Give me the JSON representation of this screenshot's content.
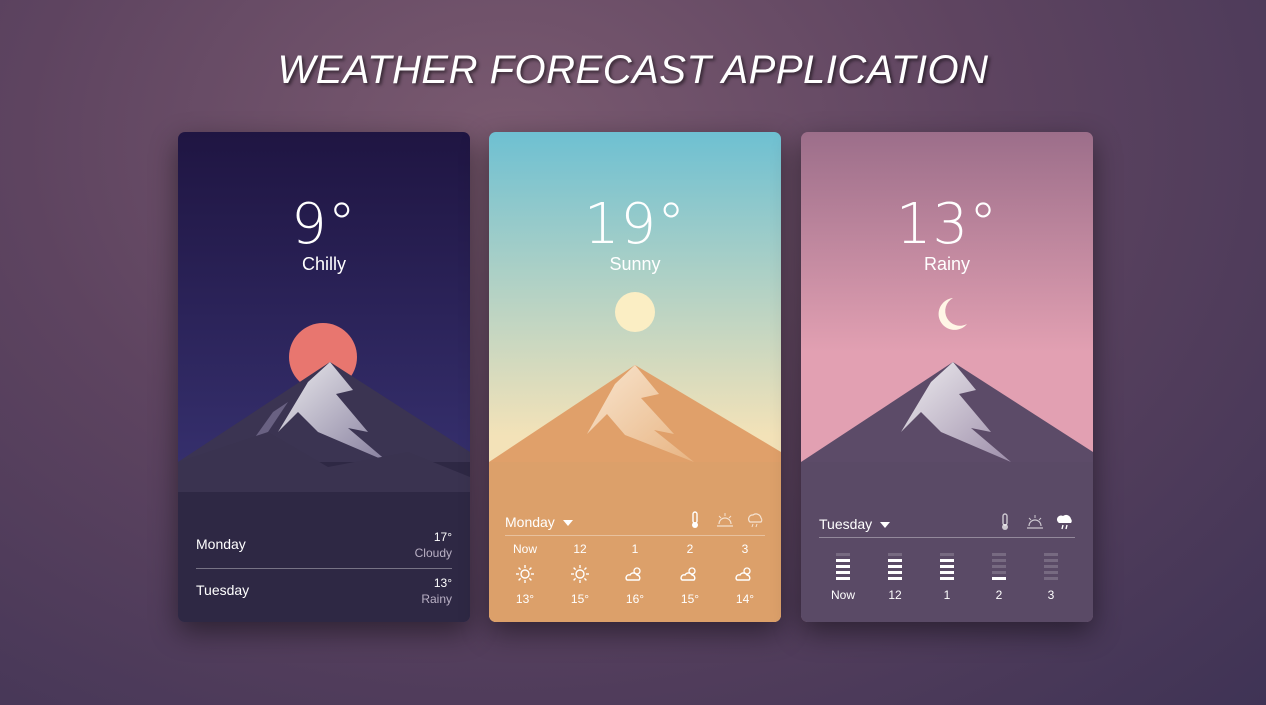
{
  "title": "WEATHER FORECAST APPLICATION",
  "cards": [
    {
      "temperature": "9°",
      "condition": "Chilly",
      "days": [
        {
          "day": "Monday",
          "temp": "17°",
          "condition": "Cloudy"
        },
        {
          "day": "Tuesday",
          "temp": "13°",
          "condition": "Rainy"
        }
      ],
      "colors": {
        "sky_top": "#1f1542",
        "sky_bottom": "#36306e",
        "sun": "#e8766f",
        "ground": "#2e2844"
      }
    },
    {
      "temperature": "19°",
      "condition": "Sunny",
      "selected_day": "Monday",
      "tab_icons": [
        "thermometer-icon",
        "sunrise-icon",
        "rain-cloud-icon"
      ],
      "hours": [
        {
          "label": "Now",
          "icon": "sun-icon",
          "temp": "13°"
        },
        {
          "label": "12",
          "icon": "sun-icon",
          "temp": "15°"
        },
        {
          "label": "1",
          "icon": "partly-cloudy-icon",
          "temp": "16°"
        },
        {
          "label": "2",
          "icon": "partly-cloudy-icon",
          "temp": "15°"
        },
        {
          "label": "3",
          "icon": "partly-cloudy-icon",
          "temp": "14°"
        }
      ],
      "colors": {
        "sky_top": "#6ec0d2",
        "sky_bottom": "#f3e2b8",
        "sun": "#fbeec4",
        "ground": "#dca06a"
      }
    },
    {
      "temperature": "13°",
      "condition": "Rainy",
      "selected_day": "Tuesday",
      "tab_icons": [
        "thermometer-icon",
        "sunrise-icon",
        "rain-cloud-icon"
      ],
      "hours": [
        {
          "label": "Now",
          "level": 4
        },
        {
          "label": "12",
          "level": 4
        },
        {
          "label": "1",
          "level": 4
        },
        {
          "label": "2",
          "level": 1
        },
        {
          "label": "3",
          "level": 0
        }
      ],
      "colors": {
        "sky_top": "#9c6e8a",
        "sky_bottom": "#e2a0b2",
        "moon": "#fff6e6",
        "ground": "#5a4a66"
      }
    }
  ]
}
